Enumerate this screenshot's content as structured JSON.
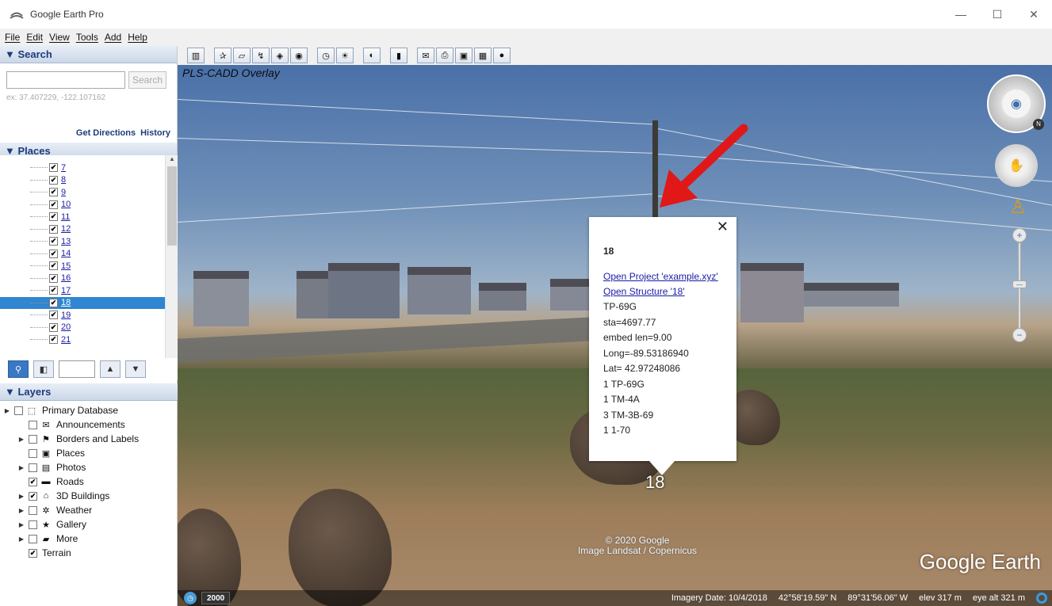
{
  "window": {
    "title": "Google Earth Pro",
    "minimize": "—",
    "maximize": "☐",
    "close": "✕"
  },
  "menu": [
    "File",
    "Edit",
    "View",
    "Tools",
    "Add",
    "Help"
  ],
  "search": {
    "header": "▼ Search",
    "placeholder": "",
    "button": "Search",
    "example": "ex: 37.407229, -122.107162",
    "get_directions": "Get Directions",
    "history": "History"
  },
  "places": {
    "header": "▼ Places",
    "items": [
      {
        "label": "7",
        "checked": true,
        "selected": false
      },
      {
        "label": "8",
        "checked": true,
        "selected": false
      },
      {
        "label": "9",
        "checked": true,
        "selected": false
      },
      {
        "label": "10",
        "checked": true,
        "selected": false
      },
      {
        "label": "11",
        "checked": true,
        "selected": false
      },
      {
        "label": "12",
        "checked": true,
        "selected": false
      },
      {
        "label": "13",
        "checked": true,
        "selected": false
      },
      {
        "label": "14",
        "checked": true,
        "selected": false
      },
      {
        "label": "15",
        "checked": true,
        "selected": false
      },
      {
        "label": "16",
        "checked": true,
        "selected": false
      },
      {
        "label": "17",
        "checked": true,
        "selected": false
      },
      {
        "label": "18",
        "checked": true,
        "selected": true
      },
      {
        "label": "19",
        "checked": true,
        "selected": false
      },
      {
        "label": "20",
        "checked": true,
        "selected": false
      },
      {
        "label": "21",
        "checked": true,
        "selected": false
      }
    ]
  },
  "layers": {
    "header": "▼ Layers",
    "items": [
      {
        "label": "Primary Database",
        "checked": false,
        "icon": "database-icon",
        "glyph": "⬚",
        "expand": true,
        "indent": 0
      },
      {
        "label": "Announcements",
        "checked": false,
        "icon": "envelope-icon",
        "glyph": "✉",
        "expand": false,
        "indent": 1
      },
      {
        "label": "Borders and Labels",
        "checked": false,
        "icon": "flag-icon",
        "glyph": "⚑",
        "expand": true,
        "indent": 1
      },
      {
        "label": "Places",
        "checked": false,
        "icon": "places-icon",
        "glyph": "▣",
        "expand": false,
        "indent": 1
      },
      {
        "label": "Photos",
        "checked": false,
        "icon": "photo-icon",
        "glyph": "▤",
        "expand": true,
        "indent": 1
      },
      {
        "label": "Roads",
        "checked": true,
        "icon": "road-icon",
        "glyph": "▬",
        "expand": false,
        "indent": 1
      },
      {
        "label": "3D Buildings",
        "checked": true,
        "icon": "building-icon",
        "glyph": "⌂",
        "expand": true,
        "indent": 1
      },
      {
        "label": "Weather",
        "checked": false,
        "icon": "weather-icon",
        "glyph": "✲",
        "expand": true,
        "indent": 1
      },
      {
        "label": "Gallery",
        "checked": false,
        "icon": "gallery-icon",
        "glyph": "★",
        "expand": true,
        "indent": 1
      },
      {
        "label": "More",
        "checked": false,
        "icon": "folder-icon",
        "glyph": "▰",
        "expand": true,
        "indent": 1
      },
      {
        "label": "Terrain",
        "checked": true,
        "icon": "",
        "glyph": "",
        "expand": false,
        "indent": 1
      }
    ]
  },
  "toolbar": {
    "icons": [
      {
        "name": "sidebar-toggle-icon",
        "glyph": "▥"
      },
      {
        "name": "gap"
      },
      {
        "name": "add-placemark-icon",
        "glyph": "✰"
      },
      {
        "name": "add-polygon-icon",
        "glyph": "▱"
      },
      {
        "name": "add-path-icon",
        "glyph": "↯"
      },
      {
        "name": "image-overlay-icon",
        "glyph": "◈"
      },
      {
        "name": "record-tour-icon",
        "glyph": "◉"
      },
      {
        "name": "gap"
      },
      {
        "name": "historical-imagery-icon",
        "glyph": "◷"
      },
      {
        "name": "sunlight-icon",
        "glyph": "☀"
      },
      {
        "name": "gap"
      },
      {
        "name": "planets-icon",
        "glyph": "◐"
      },
      {
        "name": "gap"
      },
      {
        "name": "ruler-icon",
        "glyph": "▮"
      },
      {
        "name": "gap"
      },
      {
        "name": "email-icon",
        "glyph": "✉"
      },
      {
        "name": "print-icon",
        "glyph": "⎙"
      },
      {
        "name": "save-image-icon",
        "glyph": "▣"
      },
      {
        "name": "view-in-maps-icon",
        "glyph": "▦"
      },
      {
        "name": "earth-gallery-icon",
        "glyph": "●"
      }
    ]
  },
  "view": {
    "overlay_title": "PLS-CADD Overlay",
    "pin_label": "18",
    "copyright_line1": "© 2020 Google",
    "copyright_line2": "Image Landsat / Copernicus",
    "logo": "Google Earth"
  },
  "balloon": {
    "title": "18",
    "link1": "Open Project 'example.xyz'",
    "link2": "Open Structure '18'",
    "lines": [
      "TP-69G",
      "sta=4697.77",
      "embed len=9.00",
      "Long=-89.53186940",
      "Lat= 42.97248086",
      "1 TP-69G",
      "1 TM-4A",
      "3 TM-3B-69",
      "1 1-70"
    ],
    "close": "✕"
  },
  "status": {
    "year": "2000",
    "imagery_date": "Imagery Date: 10/4/2018",
    "lat": "42°58'19.59\" N",
    "lon": "89°31'56.06\" W",
    "elev": "elev  317 m",
    "eye_alt": "eye alt  321 m"
  }
}
